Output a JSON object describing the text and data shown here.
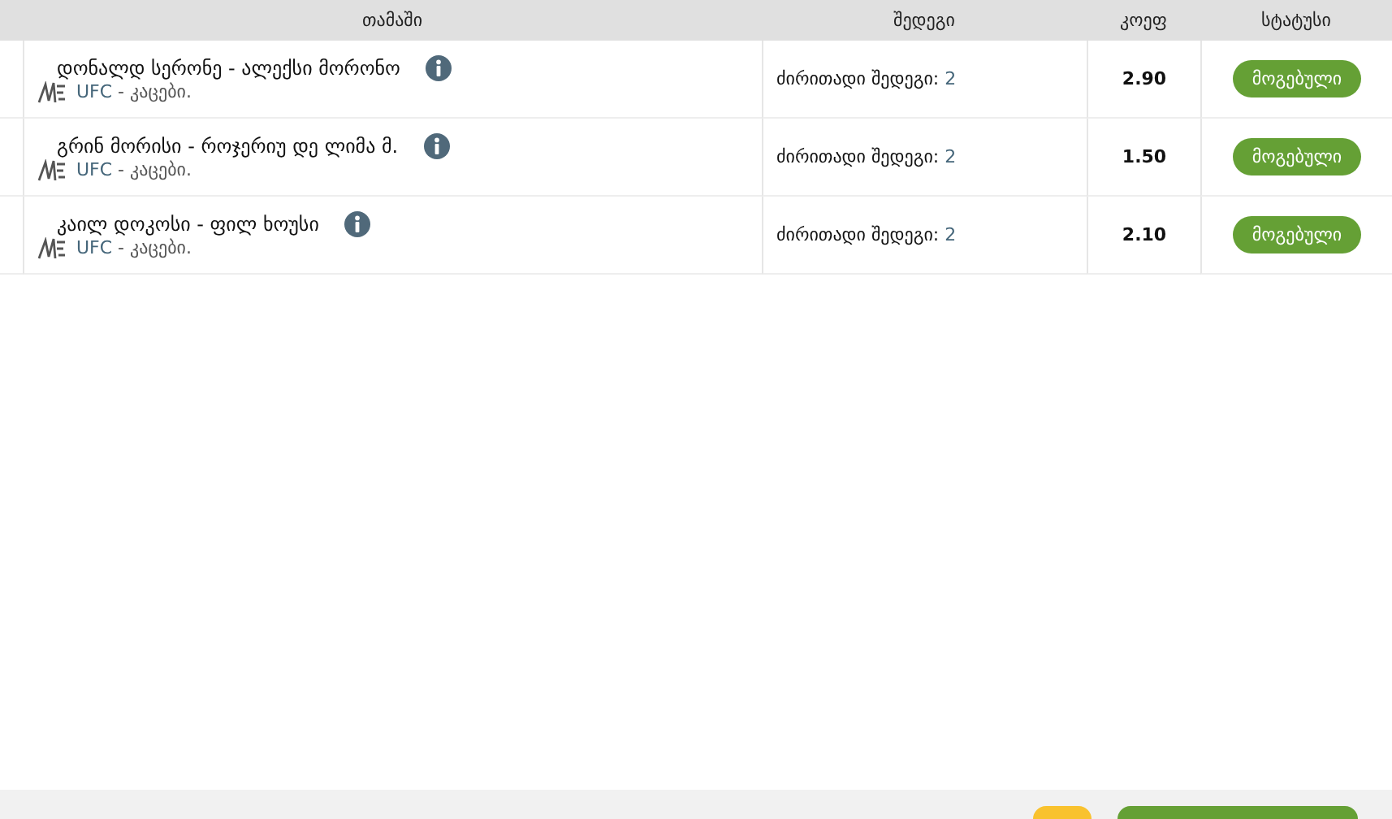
{
  "table": {
    "columns": [
      "თამაში",
      "შედეგი",
      "კოეფ",
      "სტატუსი"
    ],
    "rows": [
      {
        "match": "დონალდ სერონე - ალექსი მორონო",
        "league": "UFC",
        "category": " - კაცები.",
        "result_label": "ძირითადი შედეგი: ",
        "result_value": "2",
        "odds": "2.90",
        "status": "მოგებული"
      },
      {
        "match": "გრინ მორისი - როჯერიუ დე ლიმა მ.",
        "league": "UFC",
        "category": " - კაცები.",
        "result_label": "ძირითადი შედეგი: ",
        "result_value": "2",
        "odds": "1.50",
        "status": "მოგებული"
      },
      {
        "match": "კაილ დოკოსი - ფილ ხოუსი",
        "league": "UFC",
        "category": " - კაცები.",
        "result_label": "ძირითადი შედეგი: ",
        "result_value": "2",
        "odds": "2.10",
        "status": "მოგებული"
      }
    ]
  }
}
